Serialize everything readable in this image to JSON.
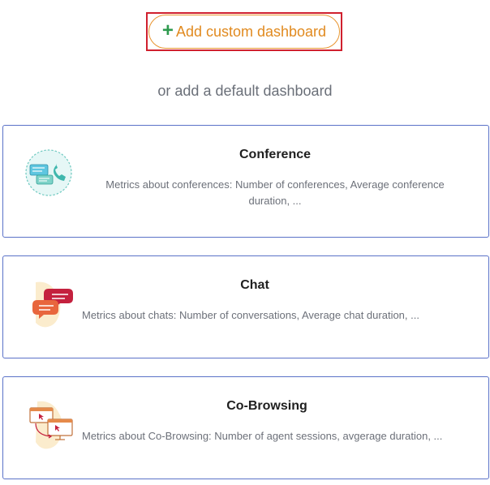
{
  "actions": {
    "add_custom_label": "Add custom dashboard",
    "add_icon": "plus-icon"
  },
  "subtitle": "or add a default dashboard",
  "dashboards": [
    {
      "title": "Conference",
      "description": "Metrics about conferences: Number of conferences, Average conference duration, ...",
      "icon": "conference-icon"
    },
    {
      "title": "Chat",
      "description": "Metrics about chats: Number of conversations, Average chat duration, ...",
      "icon": "chat-icon"
    },
    {
      "title": "Co-Browsing",
      "description": "Metrics about Co-Browsing: Number of agent sessions, avgerage duration, ...",
      "icon": "co-browsing-icon"
    }
  ],
  "colors": {
    "add_button_text": "#e18a1f",
    "add_button_border": "#e8942f",
    "plus": "#2e9a4e",
    "highlight": "#d0202e",
    "card_border": "#5b72c8"
  }
}
